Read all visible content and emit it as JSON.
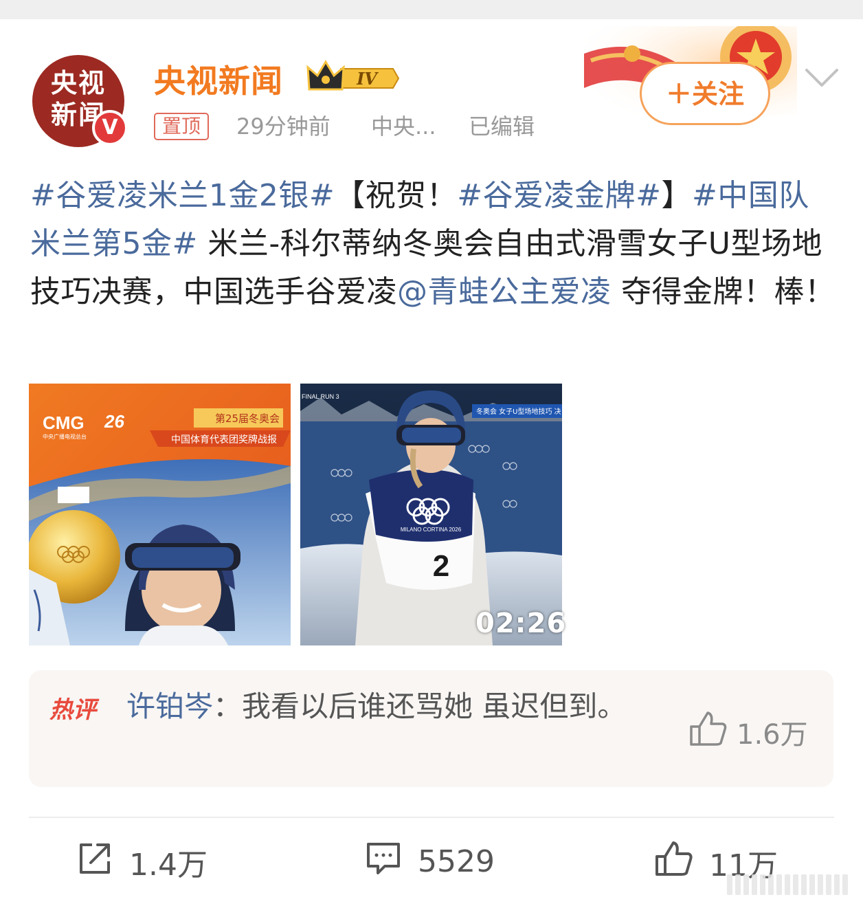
{
  "author": {
    "avatar_text_line1": "央视",
    "avatar_text_line2": "新闻",
    "name": "央视新闻",
    "level_badge": "IV",
    "verified_mark": "V"
  },
  "meta": {
    "pinned_label": "置顶",
    "time": "29分钟前",
    "source": "中央...",
    "edited": "已编辑"
  },
  "follow_label": "＋关注",
  "post": {
    "tag1": "#谷爱凌米兰1金2银#",
    "bracket_open": "【祝贺！",
    "tag2": "#谷爱凌金牌#",
    "bracket_close": "】",
    "tag3": "#中国队米兰第5金#",
    "text1": " 米兰-科尔蒂纳冬奥会自由式滑雪女子U型场地技巧决赛，中国选手谷爱凌",
    "mention": "@青蛙公主爱凌",
    "text2": " 夺得金牌！棒！"
  },
  "image1": {
    "cmg_label": "CMG",
    "cmg_sub": "中央广播电视总台",
    "banner_title": "第25届冬奥会",
    "banner_subtitle": "中国体育代表团奖牌战报"
  },
  "image2": {
    "run_label": "FINAL RUN 3",
    "overlay": "冬奥会 女子U型场地技巧 决",
    "bib_number": "2",
    "bib_text": "MILANO CORTINA 2026",
    "duration": "02:26"
  },
  "hot_comment": {
    "badge": "热评",
    "user": "许铂岑",
    "separator": "：",
    "text": "我看以后谁还骂她 虽迟但到。",
    "likes": "1.6万"
  },
  "actions": {
    "repost_count": "1.4万",
    "comment_count": "5529",
    "like_count": "11万"
  },
  "icons": {
    "crown": "crown-icon",
    "chevron": "chevron-down-icon",
    "repost": "repost-icon",
    "comment": "comment-icon",
    "like": "thumb-up-icon"
  },
  "colors": {
    "author_name": "#f27a20",
    "hashtag": "#4a6a9c",
    "follow_accent": "#f07c2c",
    "hot_badge": "#e84a3d"
  }
}
